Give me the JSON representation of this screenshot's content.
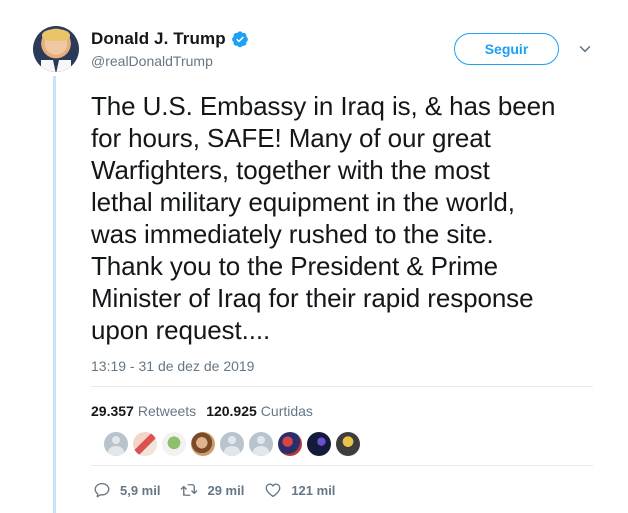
{
  "header": {
    "display_name": "Donald J. Trump",
    "handle": "@realDonaldTrump",
    "verified_icon": "verified-badge-icon",
    "follow_label": "Seguir",
    "more_icon": "chevron-down-icon"
  },
  "tweet": {
    "lines": [
      "The U.S. Embassy in Iraq is, & has been",
      "for hours, SAFE! Many of our great",
      "Warfighters, together with the most",
      "lethal military equipment in the world,",
      "was immediately rushed to the site.",
      "Thank you to the President & Prime",
      "Minister of Iraq for their rapid response",
      "upon request...."
    ],
    "timestamp": "13:19 - 31 de dez de 2019"
  },
  "stats": {
    "retweets_count": "29.357",
    "retweets_label": "Retweets",
    "likes_count": "120.925",
    "likes_label": "Curtidas"
  },
  "actions": {
    "reply_count": "5,9 mil",
    "retweet_count": "29 mil",
    "like_count": "121 mil"
  },
  "colors": {
    "accent": "#1da1f2",
    "thread_line": "#c4e4f7",
    "muted_text": "#657786"
  }
}
